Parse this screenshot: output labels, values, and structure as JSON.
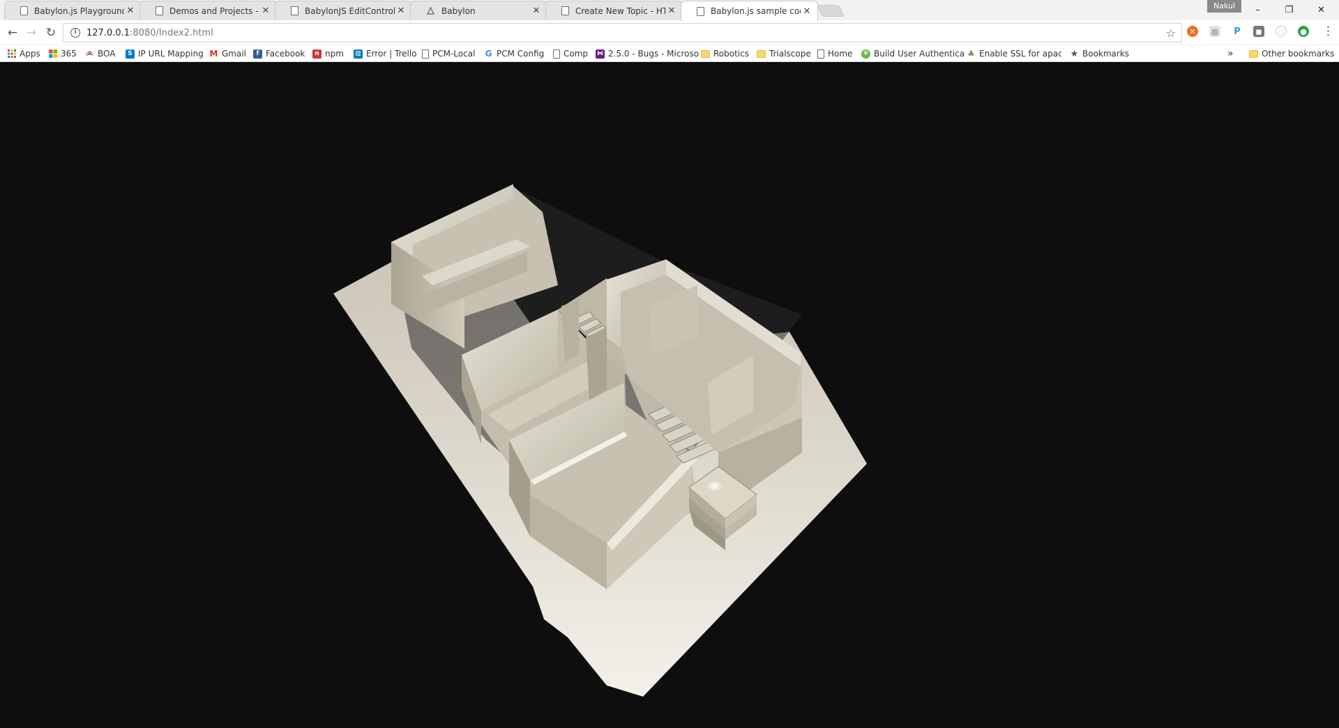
{
  "tabs": [
    {
      "title": "Babylon.js Playground",
      "icon": "page-icon"
    },
    {
      "title": "Demos and Projects - HT",
      "icon": "page-icon"
    },
    {
      "title": "BabylonJS EditControl - I",
      "icon": "page-icon"
    },
    {
      "title": "Babylon",
      "icon": "babylon-icon"
    },
    {
      "title": "Create New Topic - HTM",
      "icon": "page-icon"
    },
    {
      "title": "Babylon.js sample code",
      "icon": "page-icon",
      "active": true
    }
  ],
  "profile_name": "Nakul",
  "window_controls": {
    "minimize": "–",
    "maximize": "❐",
    "close": "✕"
  },
  "toolbar": {
    "back": "←",
    "forward": "→",
    "reload": "↻",
    "url_host": "127.0.0.1",
    "url_path": ":8080/Index2.html",
    "menu": "⋮"
  },
  "extensions": [
    {
      "name": "orange-extension-icon",
      "glyph": "✕",
      "color": "#f36c21"
    },
    {
      "name": "grid-extension-icon",
      "glyph": "▦",
      "color": "#bdbdbd"
    },
    {
      "name": "p-extension-icon",
      "glyph": "P",
      "color": "#2f9bd7"
    },
    {
      "name": "square-extension-icon",
      "glyph": "◼",
      "color": "#777777"
    },
    {
      "name": "circle-extension-icon",
      "glyph": "◯",
      "color": "#c8c8c8"
    },
    {
      "name": "green-extension-icon",
      "glyph": "●",
      "color": "#2aa24a"
    }
  ],
  "bookmarks": [
    {
      "label": "Apps",
      "icon": "apps"
    },
    {
      "label": "365",
      "icon": "ms"
    },
    {
      "label": "BOA",
      "icon": "boa"
    },
    {
      "label": "IP URL Mapping",
      "icon": "sp"
    },
    {
      "label": "Gmail",
      "icon": "gmail"
    },
    {
      "label": "Facebook",
      "icon": "fb"
    },
    {
      "label": "npm",
      "icon": "npm"
    },
    {
      "label": "Error | Trello",
      "icon": "trello"
    },
    {
      "label": "PCM-Local",
      "icon": "page"
    },
    {
      "label": "PCM Config",
      "icon": "google"
    },
    {
      "label": "Comp",
      "icon": "page"
    },
    {
      "label": "2.5.0 - Bugs - Microso",
      "icon": "vs"
    },
    {
      "label": "Robotics",
      "icon": "folder"
    },
    {
      "label": "Trialscope",
      "icon": "folder"
    },
    {
      "label": "Home",
      "icon": "page"
    },
    {
      "label": "Build User Authentica",
      "icon": "spring"
    },
    {
      "label": "Enable SSL for apache",
      "icon": "tree"
    },
    {
      "label": "Bookmarks",
      "icon": "star"
    }
  ],
  "bookmarks_overflow": "»",
  "other_bookmarks": "Other bookmarks",
  "scene": {
    "background": "#0e0e0e",
    "wall_color": "#cfcab9",
    "ground_color": "#e7e2d6"
  }
}
